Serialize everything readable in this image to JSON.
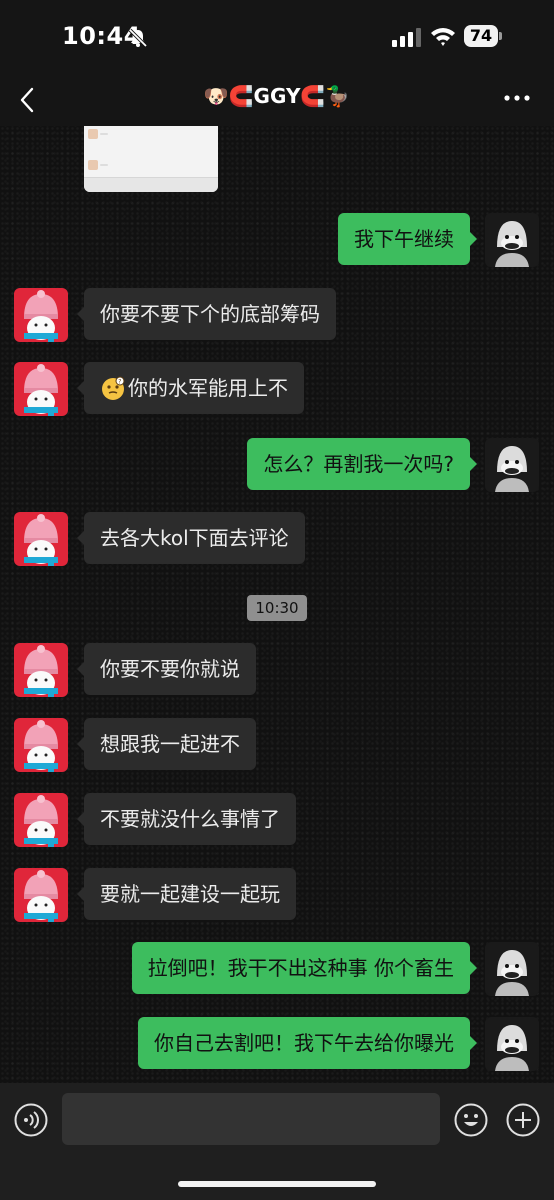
{
  "status_bar": {
    "time": "10:44",
    "battery": "74"
  },
  "header": {
    "title": "🐶🧲GGY🧲🦆"
  },
  "messages": [
    {
      "side": "out",
      "text": "我下午继续"
    },
    {
      "side": "in",
      "text": "你要不要下个的底部筹码"
    },
    {
      "side": "in",
      "text": "你的水军能用上不"
    },
    {
      "side": "out",
      "text": "怎么？再割我一次吗?"
    },
    {
      "side": "in",
      "text": "去各大kol下面去评论"
    },
    {
      "side": "in",
      "text": "你要不要你就说"
    },
    {
      "side": "in",
      "text": "想跟我一起进不"
    },
    {
      "side": "in",
      "text": "不要就没什么事情了"
    },
    {
      "side": "in",
      "text": "要就一起建设一起玩"
    },
    {
      "side": "out",
      "text": "拉倒吧！我干不出这种事 你个畜生"
    },
    {
      "side": "out",
      "text": "你自己去割吧！我下午去给你曝光"
    }
  ],
  "timestamp": "10:30",
  "icons": {
    "back": "chevron-left-icon",
    "more": "more-icon",
    "voice": "voice-icon",
    "emoji": "emoji-icon",
    "add": "plus-icon",
    "thinking": "thinking-emoji"
  },
  "colors": {
    "outgoing_bubble": "#3dbd5e",
    "incoming_bubble": "#2c2c2c",
    "background": "#111111"
  }
}
